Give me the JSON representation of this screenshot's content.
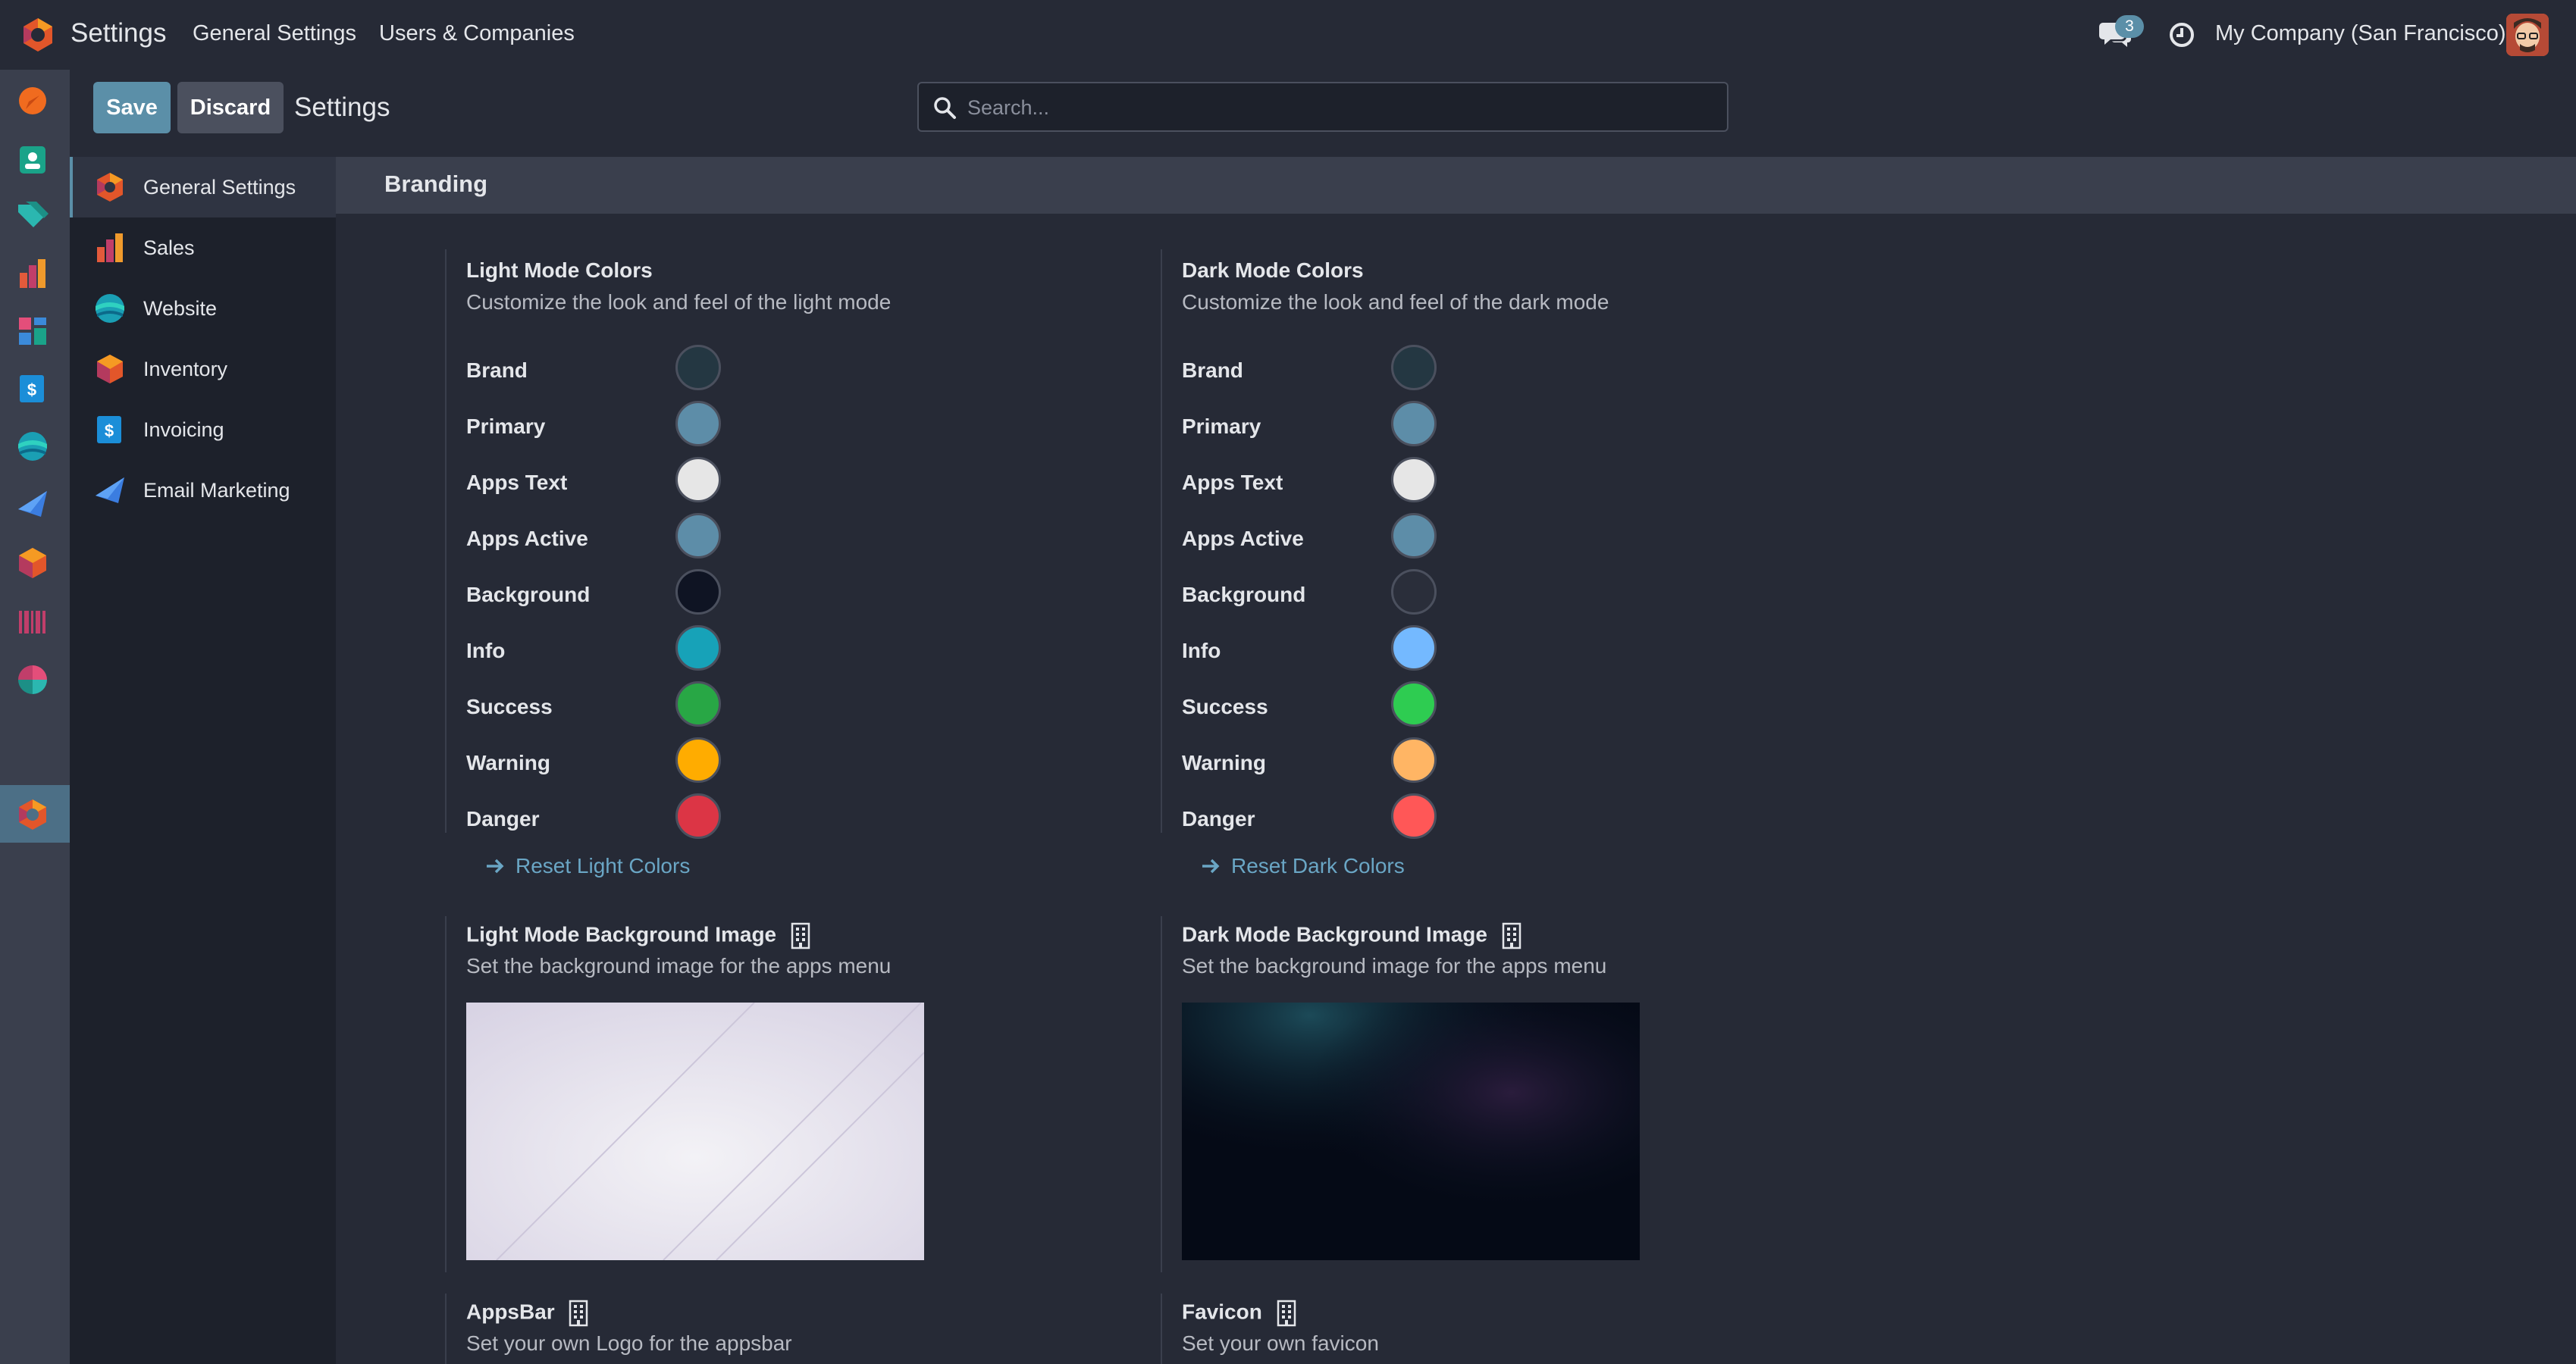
{
  "navbar": {
    "app_title": "Settings",
    "menu": [
      "General Settings",
      "Users & Companies"
    ],
    "messages_count": "3",
    "company": "My Company (San Francisco)"
  },
  "appbar": {
    "icons": [
      "discuss-icon",
      "contacts-icon",
      "crm-icon",
      "sales-icon",
      "dashboards-icon",
      "invoicing-icon",
      "website-icon",
      "email-marketing-icon",
      "inventory-icon",
      "barcode-icon",
      "reporting-icon",
      "settings-icon"
    ]
  },
  "control": {
    "save_label": "Save",
    "discard_label": "Discard",
    "title": "Settings",
    "search_placeholder": "Search..."
  },
  "settings_menu": {
    "items": [
      {
        "label": "General Settings",
        "icon": "settings-icon"
      },
      {
        "label": "Sales",
        "icon": "sales-icon"
      },
      {
        "label": "Website",
        "icon": "website-icon"
      },
      {
        "label": "Inventory",
        "icon": "inventory-icon"
      },
      {
        "label": "Invoicing",
        "icon": "invoicing-icon"
      },
      {
        "label": "Email Marketing",
        "icon": "email-marketing-icon"
      }
    ]
  },
  "branding": {
    "section_title": "Branding",
    "light": {
      "title": "Light Mode Colors",
      "desc": "Customize the look and feel of the light mode",
      "rows": [
        {
          "label": "Brand",
          "color": "#243742"
        },
        {
          "label": "Primary",
          "color": "#5d8da8"
        },
        {
          "label": "Apps Text",
          "color": "#e6e6e6"
        },
        {
          "label": "Apps Active",
          "color": "#5d8da8"
        },
        {
          "label": "Background",
          "color": "#0f1423"
        },
        {
          "label": "Info",
          "color": "#17a2b8"
        },
        {
          "label": "Success",
          "color": "#28a745"
        },
        {
          "label": "Warning",
          "color": "#ffac00"
        },
        {
          "label": "Danger",
          "color": "#dc3545"
        }
      ],
      "reset_label": "Reset Light Colors"
    },
    "dark": {
      "title": "Dark Mode Colors",
      "desc": "Customize the look and feel of the dark mode",
      "rows": [
        {
          "label": "Brand",
          "color": "#243742"
        },
        {
          "label": "Primary",
          "color": "#5d8da8"
        },
        {
          "label": "Apps Text",
          "color": "#e6e6e6"
        },
        {
          "label": "Apps Active",
          "color": "#5d8da8"
        },
        {
          "label": "Background",
          "color": "#2a2e3a"
        },
        {
          "label": "Info",
          "color": "#74b9ff"
        },
        {
          "label": "Success",
          "color": "#2ecc51"
        },
        {
          "label": "Warning",
          "color": "#ffb564"
        },
        {
          "label": "Danger",
          "color": "#ff5757"
        }
      ],
      "reset_label": "Reset Dark Colors"
    },
    "light_bg": {
      "title": "Light Mode Background Image",
      "desc": "Set the background image for the apps menu"
    },
    "dark_bg": {
      "title": "Dark Mode Background Image",
      "desc": "Set the background image for the apps menu"
    },
    "appsbar": {
      "title": "AppsBar",
      "desc": "Set your own Logo for the appsbar"
    },
    "favicon": {
      "title": "Favicon",
      "desc": "Set your own favicon"
    }
  }
}
